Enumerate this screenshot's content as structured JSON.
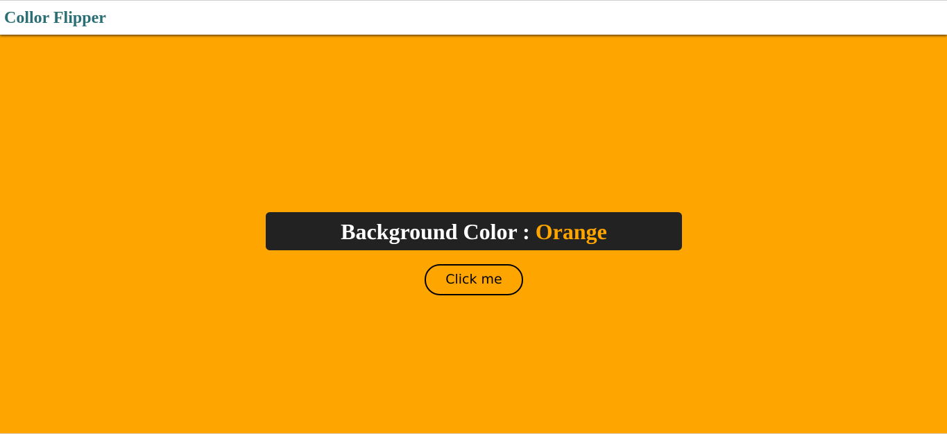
{
  "app": {
    "title": "Collor Flipper"
  },
  "display": {
    "label": "Background Color :",
    "color_name": "Orange",
    "background_color": "#ffa500",
    "label_box_color": "#222222",
    "color_name_color": "#ffa500"
  },
  "actions": {
    "click_label": "Click me"
  },
  "colors": {
    "brand": "#2a6f73",
    "label_text": "#ffffff",
    "button_border": "#000000"
  }
}
